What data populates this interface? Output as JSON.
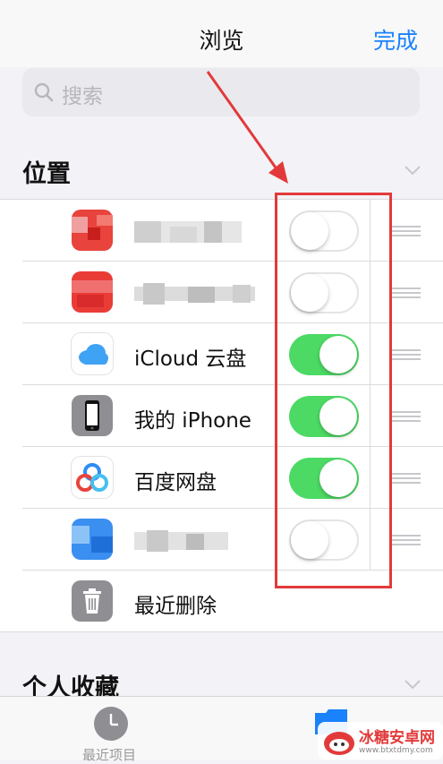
{
  "header": {
    "title": "浏览",
    "done_label": "完成"
  },
  "search": {
    "placeholder": "搜索"
  },
  "locations": {
    "title": "位置",
    "items": [
      {
        "label": "",
        "enabled": false,
        "icon": "blurred-app-icon",
        "color": "#e8433c"
      },
      {
        "label": "",
        "enabled": false,
        "icon": "blurred-app-icon",
        "color": "#ea3c36"
      },
      {
        "label": "iCloud 云盘",
        "enabled": true,
        "icon": "icloud-icon",
        "color": "#3ea2f5"
      },
      {
        "label": "我的 iPhone",
        "enabled": true,
        "icon": "iphone-icon",
        "color": "#8e8e93"
      },
      {
        "label": "百度网盘",
        "enabled": true,
        "icon": "baidu-netdisk-icon",
        "color": "#2f8cf7"
      },
      {
        "label": "",
        "enabled": false,
        "icon": "blurred-app-icon",
        "color": "#3a8ff0"
      }
    ],
    "recently_deleted": {
      "label": "最近删除",
      "icon": "trash-icon"
    }
  },
  "favorites": {
    "title": "个人收藏"
  },
  "tab_bar": {
    "recents_label": "最近项目"
  },
  "watermark": {
    "title": "冰糖安卓网",
    "url": "www.btxtdmy.com"
  },
  "colors": {
    "accent": "#1a82fb",
    "toggle_on": "#4cd964",
    "annotation": "#e23a3a"
  }
}
